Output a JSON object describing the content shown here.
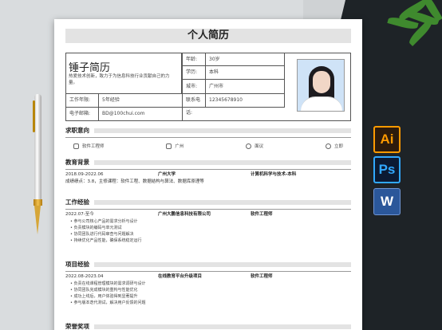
{
  "resume": {
    "title": "个人简历",
    "name": "锤子简历",
    "motto": "热爱技术创新，致力于为信息科技行业贡献自己的力量。",
    "info": {
      "age_label": "年龄:",
      "age_value": "30岁",
      "edu_label": "学历:",
      "edu_value": "本科",
      "city_label": "城市:",
      "city_value": "广州市",
      "exp_label": "工作年限:",
      "exp_value": "5年经验",
      "phone_label": "联系电话:",
      "phone_value": "12345678910",
      "email_label": "电子邮箱:",
      "email_value": "BD@100chui.com"
    },
    "intent": {
      "title": "求职意向",
      "job": "软件工程师",
      "city": "广州",
      "salary": "面议",
      "status": "立即"
    },
    "education": {
      "title": "教育背景",
      "date": "2018.09-2022.06",
      "school": "广州大学",
      "major": "计算机科学与技术-本科",
      "detail": "成绩绩点：3.8，主修课程：软件工程、数据结构与算法、数据库原理等"
    },
    "work": {
      "title": "工作经验",
      "date": "2022.07-至今",
      "company": "广州大鹏信息科技有限公司",
      "role": "软件工程师",
      "bullets": [
        "参与公司核心产品的需求分析与设计",
        "负责模块的编码与单元测试",
        "协同团队进行代码审查与问题解决",
        "持续优化产品性能，确保系统稳定运行"
      ]
    },
    "project": {
      "title": "项目经验",
      "date": "2022.08-2023.04",
      "name": "在线教育平台升级项目",
      "role": "软件工程师",
      "bullets": [
        "负责在线课程管理模块的需求调研与设计",
        "协同团队完成模块的重构与性能优化",
        "成功上线后，用户体验得到显著提升",
        "参与版本迭代测试，解决用户反馈的问题"
      ]
    },
    "next_section": "荣誉奖项"
  },
  "apps": {
    "ai": "Ai",
    "ps": "Ps",
    "word": "W"
  },
  "colors": {
    "desk_dark": "#1e2327",
    "section_bar": "#e3e3e3"
  }
}
